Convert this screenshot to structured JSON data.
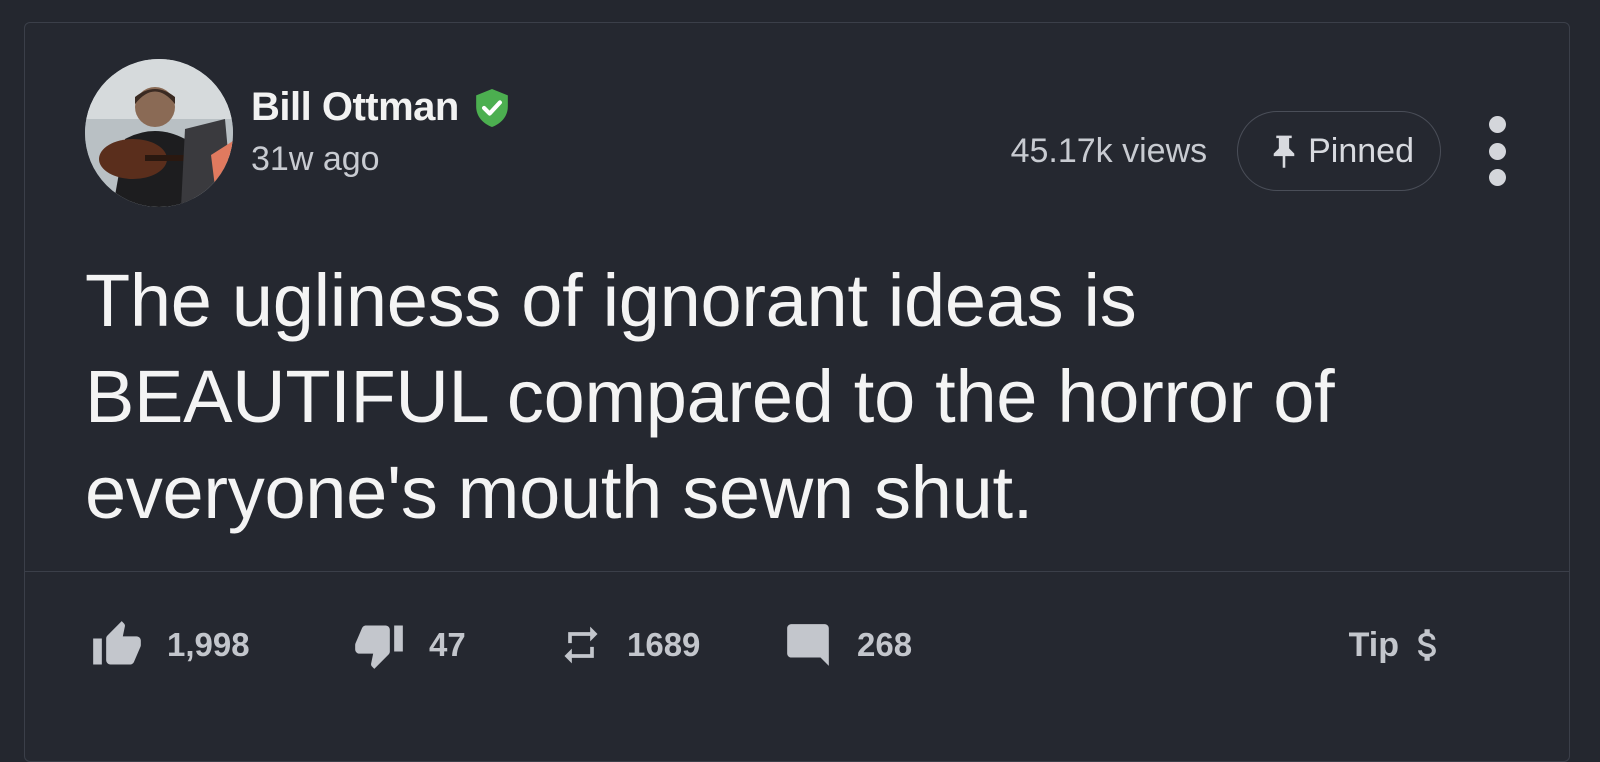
{
  "post": {
    "author": {
      "name": "Bill Ottman",
      "verified_icon": "verified-check-icon",
      "verified_color": "#4caf50",
      "time": "31w ago"
    },
    "views": "45.17k views",
    "pinned_label": "Pinned",
    "text": "The ugliness of ignorant ideas is BEAUTIFUL compared to the horror of everyone's mouth sewn shut.",
    "actions": {
      "upvotes": "1,998",
      "downvotes": "47",
      "reminds": "1689",
      "comments": "268",
      "tip_label": "Tip"
    }
  },
  "colors": {
    "background": "#24272f",
    "border": "#3b3f49",
    "text": "#f4f4f4",
    "muted": "#c3c6cc"
  }
}
